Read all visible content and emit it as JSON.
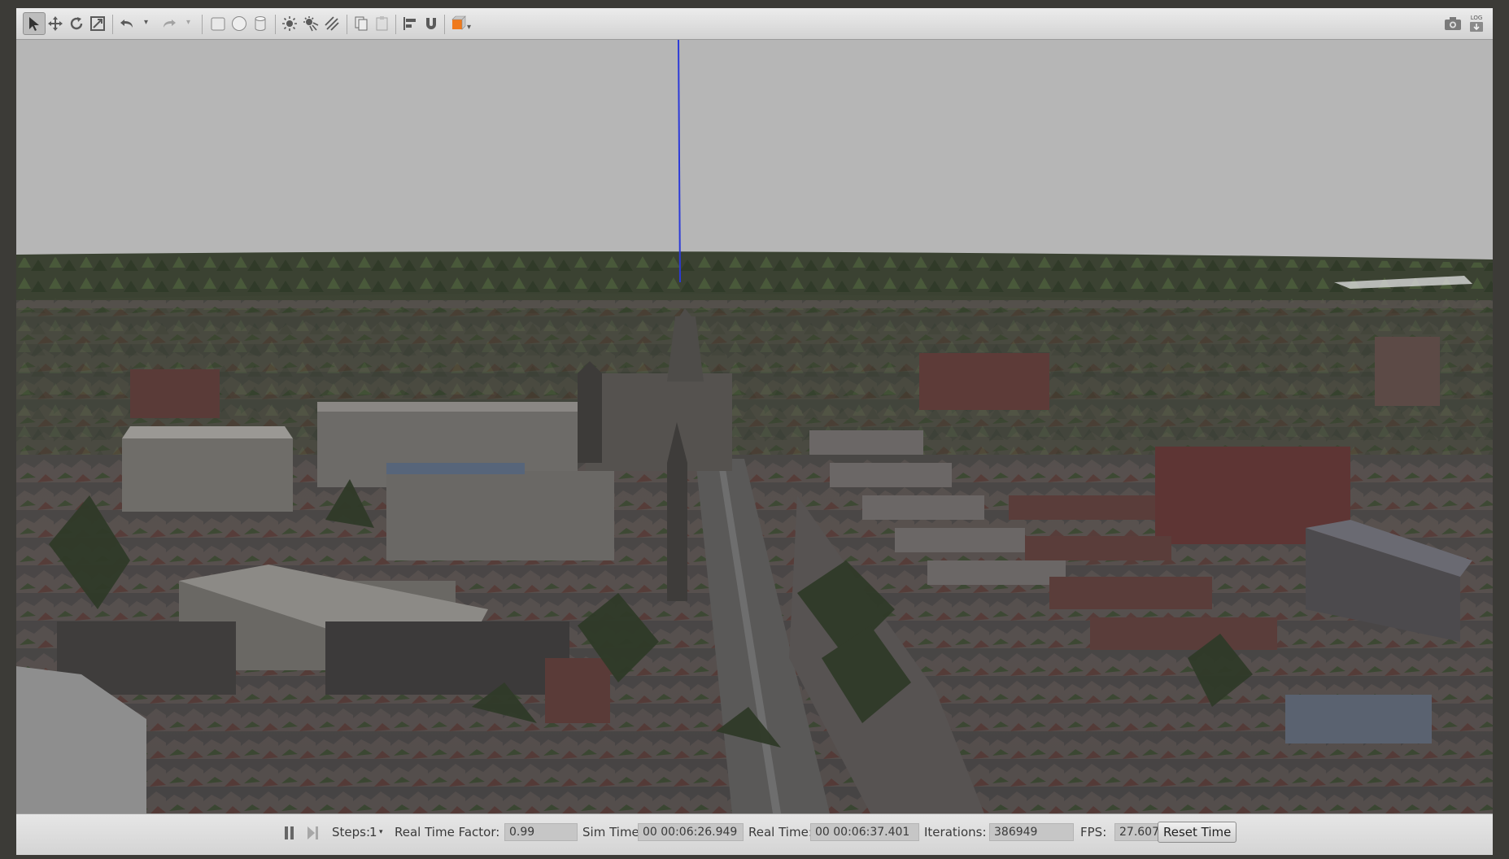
{
  "toolbar": {
    "tools": [
      {
        "name": "select-tool-icon"
      },
      {
        "name": "translate-tool-icon"
      },
      {
        "name": "rotate-tool-icon"
      },
      {
        "name": "scale-tool-icon"
      },
      {
        "name": "undo-icon"
      },
      {
        "name": "redo-icon"
      },
      {
        "name": "box-shape-icon"
      },
      {
        "name": "sphere-shape-icon"
      },
      {
        "name": "cylinder-shape-icon"
      },
      {
        "name": "point-light-icon"
      },
      {
        "name": "spot-light-icon"
      },
      {
        "name": "directional-light-icon"
      },
      {
        "name": "copy-icon"
      },
      {
        "name": "paste-icon"
      },
      {
        "name": "align-icon"
      },
      {
        "name": "snap-magnet-icon"
      },
      {
        "name": "view-angle-icon"
      },
      {
        "name": "screenshot-camera-icon"
      },
      {
        "name": "log-icon"
      }
    ],
    "log_label": "LOG"
  },
  "bottom_bar": {
    "steps_label": "Steps:",
    "steps_value": "1",
    "rtf_label": "Real Time Factor:",
    "rtf_value": "0.99",
    "sim_time_label": "Sim Time:",
    "sim_time_value": "00 00:06:26.949",
    "real_time_label": "Real Time:",
    "real_time_value": "00 00:06:37.401",
    "iterations_label": "Iterations:",
    "iterations_value": "386949",
    "fps_label": "FPS:",
    "fps_value": "27.6071",
    "reset_label": "Reset Time"
  },
  "colors": {
    "sky": "#b6b6b6",
    "axis_line": "#2c3ad8",
    "accent_orange": "#f07a1c"
  }
}
